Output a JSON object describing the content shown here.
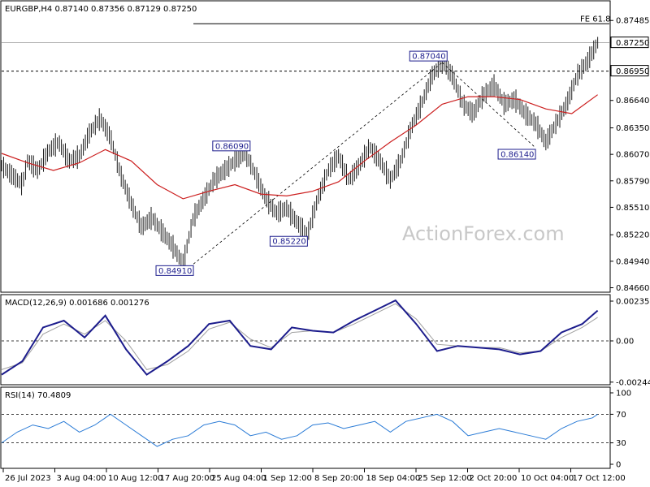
{
  "colors": {
    "candles": "#1a1a1a",
    "ma": "#cc1f1f",
    "macd_line": "#1c1c8c",
    "macd_signal": "#a0a0a0",
    "rsi": "#2a7bd6",
    "grid_dash": "#000000",
    "label": "#1c1c8c"
  },
  "chart_data": [
    {
      "type": "line",
      "panel": "price",
      "header": "EURGBP,H4  0.87140 0.87356 0.87129 0.87250",
      "watermark": "ActionForex.com",
      "ylim": [
        0.8463,
        0.8765
      ],
      "y_ticks": [
        "0.87485",
        "0.87250",
        "0.86950",
        "0.86640",
        "0.86350",
        "0.86070",
        "0.85790",
        "0.85510",
        "0.85220",
        "0.84940",
        "0.84660"
      ],
      "x_tick_labels": [
        "26 Jul 2023",
        "3 Aug 04:00",
        "10 Aug 12:00",
        "17 Aug 20:00",
        "25 Aug 04:00",
        "1 Sep 12:00",
        "8 Sep 20:00",
        "18 Sep 04:00",
        "25 Sep 12:00",
        "2 Oct 20:00",
        "10 Oct 04:00",
        "17 Oct 12:00"
      ],
      "series": [
        {
          "role": "price",
          "x": [
            0,
            2,
            4,
            5,
            7,
            9,
            11,
            13,
            15,
            17,
            19,
            21,
            23,
            25,
            27,
            29,
            31,
            33,
            35,
            37,
            39,
            41,
            43,
            45,
            47,
            49,
            51,
            53,
            55,
            57,
            59,
            61,
            63,
            65,
            67,
            69,
            71,
            73,
            75,
            77,
            79,
            81,
            83,
            85,
            87,
            89,
            91,
            93,
            95,
            97,
            99,
            101,
            103,
            105,
            107,
            108,
            109,
            110,
            111,
            113,
            115
          ],
          "y": [
            0.8595,
            0.8585,
            0.8575,
            0.86,
            0.859,
            0.861,
            0.862,
            0.86,
            0.8605,
            0.863,
            0.8645,
            0.8625,
            0.8585,
            0.8555,
            0.853,
            0.854,
            0.8525,
            0.851,
            0.8491,
            0.854,
            0.856,
            0.858,
            0.859,
            0.86,
            0.8609,
            0.8585,
            0.856,
            0.8545,
            0.855,
            0.8535,
            0.8522,
            0.856,
            0.859,
            0.8605,
            0.858,
            0.8595,
            0.8615,
            0.86,
            0.858,
            0.86,
            0.8635,
            0.866,
            0.869,
            0.8704,
            0.869,
            0.866,
            0.865,
            0.867,
            0.868,
            0.866,
            0.8665,
            0.865,
            0.864,
            0.862,
            0.864,
            0.865,
            0.866,
            0.8675,
            0.869,
            0.8705,
            0.8725
          ]
        },
        {
          "role": "moving-average",
          "x": [
            0,
            5,
            10,
            15,
            20,
            25,
            30,
            35,
            40,
            45,
            50,
            55,
            60,
            65,
            70,
            75,
            80,
            85,
            90,
            95,
            100,
            105,
            110,
            115
          ],
          "y": [
            0.8608,
            0.8598,
            0.859,
            0.8598,
            0.8612,
            0.86,
            0.8575,
            0.856,
            0.8568,
            0.8575,
            0.8565,
            0.8563,
            0.8568,
            0.8578,
            0.86,
            0.862,
            0.8638,
            0.866,
            0.8668,
            0.8668,
            0.8665,
            0.8655,
            0.865,
            0.867
          ]
        }
      ],
      "lines": [
        {
          "label": "0.86950",
          "y": 0.8695,
          "style": "dashed",
          "from_x": 0,
          "to_x": 116
        },
        {
          "label": "FE 61.8",
          "y": 0.8745,
          "style": "solid",
          "from_x": 37,
          "to_x": 116
        }
      ],
      "trend_lines": [
        {
          "x": [
            37,
            85
          ],
          "y": [
            0.8491,
            0.8704
          ]
        },
        {
          "x": [
            85,
            103
          ],
          "y": [
            0.8704,
            0.8614
          ]
        }
      ],
      "current_price_label": "0.87250",
      "annotations": [
        {
          "text": "0.84910",
          "x": 37,
          "y": 0.8491,
          "pos": "below-left"
        },
        {
          "text": "0.86090",
          "x": 47,
          "y": 0.8609,
          "pos": "above-left"
        },
        {
          "text": "0.85220",
          "x": 59,
          "y": 0.8522,
          "pos": "below-left"
        },
        {
          "text": "0.87040",
          "x": 85,
          "y": 0.8704,
          "pos": "above-left"
        },
        {
          "text": "0.86140",
          "x": 103,
          "y": 0.8614,
          "pos": "below-left"
        }
      ]
    },
    {
      "type": "line",
      "panel": "macd",
      "header": "MACD(12,26,9) 0.001686 0.001276",
      "ylim": [
        -0.0025,
        0.0025
      ],
      "y_ticks": [
        {
          "label": "0.002356",
          "value": 0.002356
        },
        {
          "label": "0.00",
          "value": 0
        },
        {
          "label": "-0.002442",
          "value": -0.002442
        }
      ],
      "zero_line": 0,
      "series": [
        {
          "role": "macd",
          "x": [
            0,
            4,
            8,
            12,
            16,
            20,
            24,
            28,
            32,
            36,
            40,
            44,
            48,
            52,
            56,
            60,
            64,
            68,
            72,
            76,
            80,
            84,
            88,
            92,
            96,
            100,
            104,
            108,
            112,
            115
          ],
          "y": [
            -0.002,
            -0.0012,
            0.0008,
            0.0012,
            0.0002,
            0.0015,
            -0.0005,
            -0.002,
            -0.0012,
            -0.0003,
            0.001,
            0.0012,
            -0.0003,
            -0.0005,
            0.0008,
            0.0006,
            0.0005,
            0.0012,
            0.0018,
            0.0024,
            0.001,
            -0.0006,
            -0.0003,
            -0.0004,
            -0.0005,
            -0.0008,
            -0.0006,
            0.0005,
            0.001,
            0.0018
          ]
        },
        {
          "role": "signal",
          "x": [
            0,
            4,
            8,
            12,
            16,
            20,
            24,
            28,
            32,
            36,
            40,
            44,
            48,
            52,
            56,
            60,
            64,
            68,
            72,
            76,
            80,
            84,
            88,
            92,
            96,
            100,
            104,
            108,
            112,
            115
          ],
          "y": [
            -0.0017,
            -0.0013,
            0.0004,
            0.001,
            0.0004,
            0.0012,
            0.0,
            -0.0017,
            -0.0014,
            -0.0006,
            0.0007,
            0.0011,
            0.0001,
            -0.0004,
            0.0005,
            0.0006,
            0.0005,
            0.001,
            0.0016,
            0.0022,
            0.0013,
            -0.0002,
            -0.0003,
            -0.0004,
            -0.0004,
            -0.0007,
            -0.0006,
            0.0002,
            0.0008,
            0.0014
          ]
        }
      ]
    },
    {
      "type": "line",
      "panel": "rsi",
      "header": "RSI(14) 70.4809",
      "ylim": [
        0,
        100
      ],
      "y_ticks": [
        {
          "label": "100",
          "value": 100
        },
        {
          "label": "70",
          "value": 70
        },
        {
          "label": "30",
          "value": 30
        },
        {
          "label": "0",
          "value": 0
        }
      ],
      "levels": [
        70,
        30
      ],
      "series": [
        {
          "role": "rsi",
          "x": [
            0,
            3,
            6,
            9,
            12,
            15,
            18,
            21,
            24,
            27,
            30,
            33,
            36,
            39,
            42,
            45,
            48,
            51,
            54,
            57,
            60,
            63,
            66,
            69,
            72,
            75,
            78,
            81,
            84,
            87,
            90,
            93,
            96,
            99,
            102,
            105,
            108,
            111,
            114,
            115
          ],
          "y": [
            30,
            45,
            55,
            50,
            60,
            45,
            55,
            70,
            55,
            40,
            25,
            35,
            40,
            55,
            60,
            55,
            40,
            45,
            35,
            40,
            55,
            58,
            50,
            55,
            60,
            45,
            60,
            65,
            70,
            60,
            40,
            45,
            50,
            45,
            40,
            35,
            50,
            60,
            65,
            70
          ]
        }
      ]
    }
  ]
}
